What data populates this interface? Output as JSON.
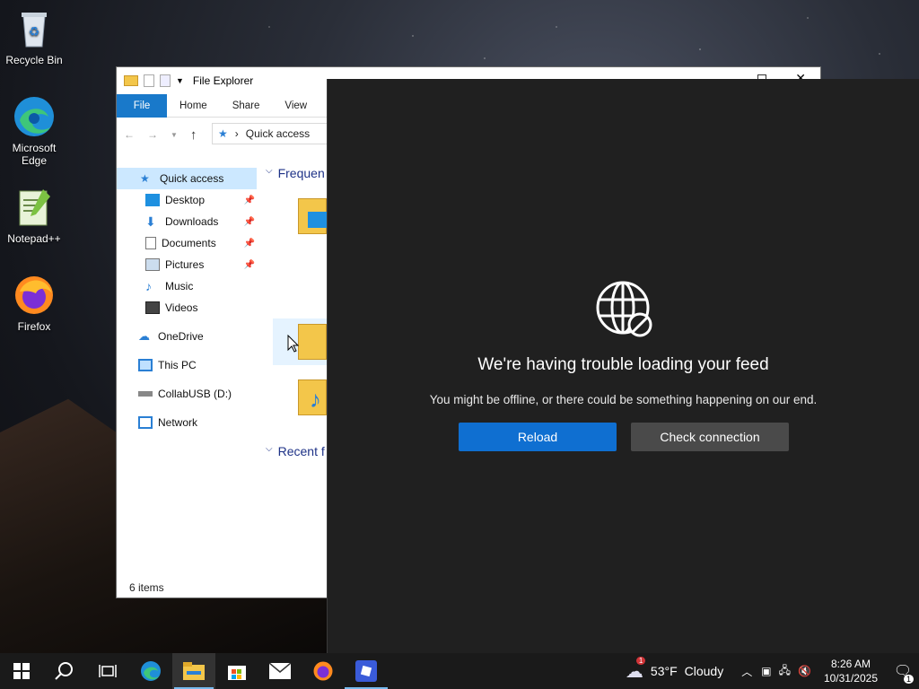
{
  "desktop": {
    "icons": [
      {
        "label": "Recycle Bin",
        "icon": "recycle-bin-icon"
      },
      {
        "label": "Microsoft Edge",
        "icon": "edge-icon"
      },
      {
        "label": "Notepad++",
        "icon": "notepadpp-icon"
      },
      {
        "label": "Firefox",
        "icon": "firefox-icon"
      }
    ]
  },
  "explorer": {
    "title": "File Explorer",
    "ribbon_tabs": [
      "File",
      "Home",
      "Share",
      "View"
    ],
    "address": "Quick access",
    "sections": {
      "frequent": "Frequen",
      "recent": "Recent f"
    },
    "nav": [
      {
        "label": "Quick access",
        "icon": "star-icon",
        "selected": true
      },
      {
        "label": "Desktop",
        "icon": "desktop-folder-icon",
        "pinned": true
      },
      {
        "label": "Downloads",
        "icon": "download-arrow-icon",
        "pinned": true
      },
      {
        "label": "Documents",
        "icon": "documents-icon",
        "pinned": true
      },
      {
        "label": "Pictures",
        "icon": "pictures-icon",
        "pinned": true
      },
      {
        "label": "Music",
        "icon": "music-note-icon"
      },
      {
        "label": "Videos",
        "icon": "videos-icon"
      },
      {
        "label": "OneDrive",
        "icon": "cloud-icon"
      },
      {
        "label": "This PC",
        "icon": "monitor-icon"
      },
      {
        "label": "CollabUSB (D:)",
        "icon": "drive-icon"
      },
      {
        "label": "Network",
        "icon": "network-icon"
      }
    ],
    "status": "6 items"
  },
  "feed": {
    "title": "We're having trouble loading your feed",
    "subtitle": "You might be offline, or there could be something happening on our end.",
    "reload_label": "Reload",
    "check_label": "Check connection",
    "accent": "#0f6fd1"
  },
  "taskbar": {
    "weather": {
      "temp": "53°F",
      "condition": "Cloudy",
      "badge": "1"
    },
    "time": "8:26 AM",
    "date": "10/31/2025",
    "notification_count": "1"
  }
}
